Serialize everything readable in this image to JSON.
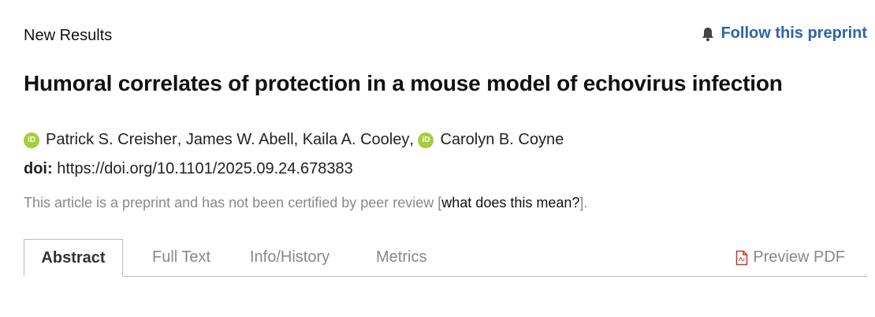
{
  "header": {
    "section_label": "New Results",
    "follow_label": "Follow this preprint",
    "follow_icon": "bell-icon",
    "accent_color": "#2a64b0"
  },
  "article": {
    "title": "Humoral correlates of protection in a mouse model of echovirus infection",
    "authors": [
      {
        "name": "Patrick S. Creisher",
        "orcid": true
      },
      {
        "name": "James W. Abell",
        "orcid": false
      },
      {
        "name": "Kaila A. Cooley",
        "orcid": false
      },
      {
        "name": "Carolyn B. Coyne",
        "orcid": true
      }
    ],
    "orcid_icon": "orcid-icon",
    "orcid_color": "#a6ce39",
    "doi_label": "doi:",
    "doi_value": "https://doi.org/10.1101/2025.09.24.678383",
    "notice_text": "This article is a preprint and has not been certified by peer review [",
    "notice_link": "what does this mean?",
    "notice_end": "]."
  },
  "tabs": [
    {
      "label": "Abstract",
      "active": true
    },
    {
      "label": "Full Text",
      "active": false
    },
    {
      "label": "Info/History",
      "active": false
    },
    {
      "label": "Metrics",
      "active": false
    }
  ],
  "pdf": {
    "label": "Preview PDF",
    "icon": "pdf-file-icon",
    "icon_color": "#c0392b"
  }
}
